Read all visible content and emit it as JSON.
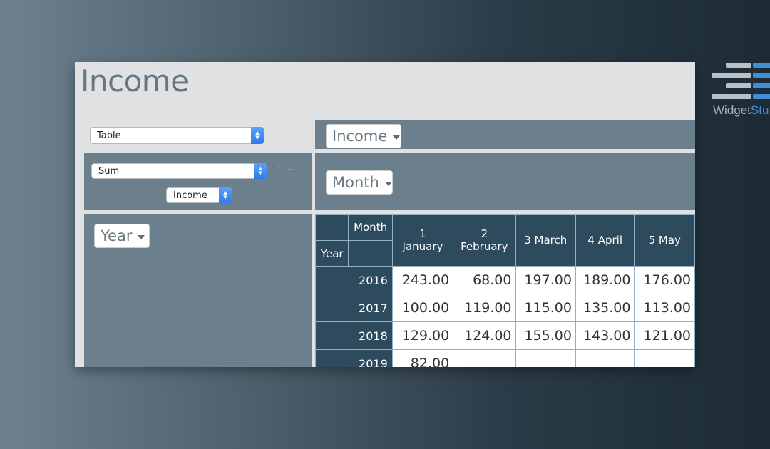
{
  "page": {
    "title": "Income"
  },
  "controls": {
    "view_select": "Table",
    "aggregate_select": "Sum",
    "value_field_select": "Income",
    "swap_arrows": "↕ ↔"
  },
  "pivot": {
    "value_chip": "Income",
    "column_chip": "Month",
    "row_chip": "Year",
    "corner_col_label": "Month",
    "corner_row_label": "Year",
    "columns": [
      {
        "num": "1",
        "name": "January"
      },
      {
        "num": "2",
        "name": "February"
      },
      {
        "num": "3",
        "name": "March"
      },
      {
        "num": "4",
        "name": "April"
      },
      {
        "num": "5",
        "name": "May"
      }
    ],
    "rows": [
      {
        "year": "2016",
        "values": [
          "243.00",
          "68.00",
          "197.00",
          "189.00",
          "176.00"
        ]
      },
      {
        "year": "2017",
        "values": [
          "100.00",
          "119.00",
          "115.00",
          "135.00",
          "113.00"
        ]
      },
      {
        "year": "2018",
        "values": [
          "129.00",
          "124.00",
          "155.00",
          "143.00",
          "121.00"
        ]
      },
      {
        "year": "2019",
        "values": [
          "82.00",
          "",
          "",
          "",
          ""
        ]
      }
    ]
  },
  "brand": {
    "part1": "Widget",
    "part2": "Stu",
    "primary_color": "#3f8fd6",
    "secondary_color": "#b9c1c7"
  }
}
